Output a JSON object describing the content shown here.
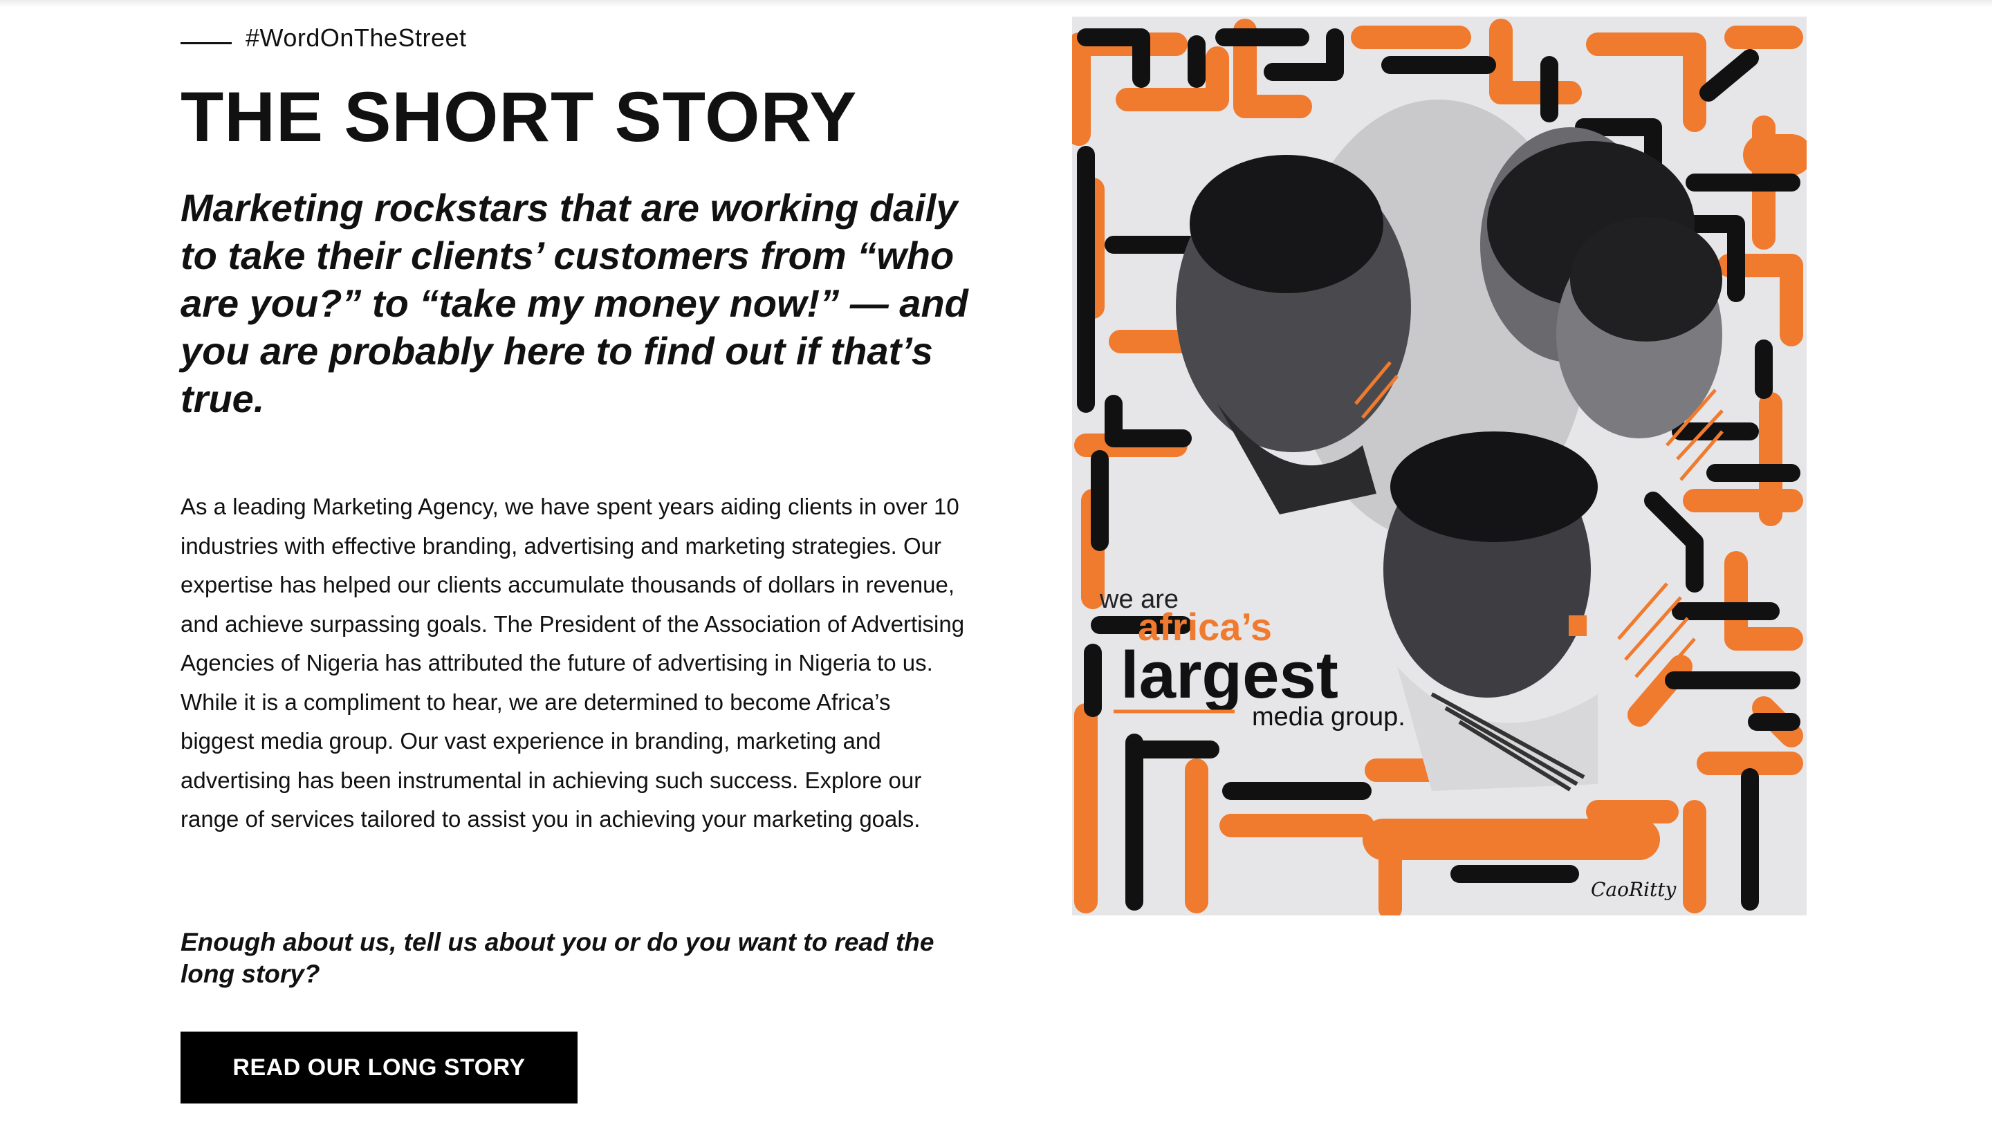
{
  "section": {
    "eyebrow": "#WordOnTheStreet",
    "title": "THE SHORT STORY",
    "lede": "Marketing rockstars that are working daily to take their clients’ customers from “who are you?” to “take my money now!” — and you are probably here to find out if that’s true.",
    "body": "As a leading Marketing Agency, we have spent years aiding clients in over 10 industries with effective branding, advertising and marketing strategies. Our expertise has helped our clients accumulate thousands of dollars in revenue, and achieve surpassing goals. The President of the Association of Advertising Agencies of Nigeria has attributed the future of advertising in Nigeria to us. While it is a compliment to hear, we are determined to become Africa’s biggest media group. Our vast experience in branding, marketing and advertising has been instrumental in achieving such success. Explore our range of services tailored to assist you in achieving your marketing goals.",
    "cta_text": "Enough about us, tell us about you or do you want to read the long story?",
    "cta_button": "READ OUR LONG STORY"
  },
  "poster": {
    "tagline_small": "we are",
    "tagline_brand": "africa’s",
    "tagline_big": "largest",
    "tagline_end": "media group.",
    "accent_color": "#f07a2e",
    "ink_color": "#111111",
    "signature": "CaoRitty"
  }
}
